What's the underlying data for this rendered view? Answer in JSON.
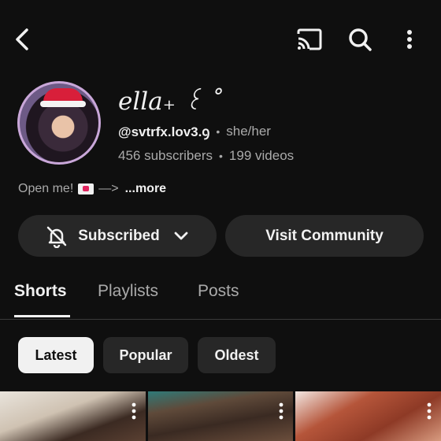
{
  "channel": {
    "name": "ella₊ ꒰ ˚",
    "handle": "@svtrfx.lov3.ꝯ",
    "pronouns": "she/her",
    "subscribers": "456 subscribers",
    "videos": "199 videos",
    "separator": "•",
    "description": "Open me!",
    "description_arrow": "—>",
    "more_label": "...more"
  },
  "buttons": {
    "subscribed_label": "Subscribed",
    "visit_community_label": "Visit Community"
  },
  "tabs": [
    {
      "label": "Shorts",
      "active": true
    },
    {
      "label": "Playlists",
      "active": false
    },
    {
      "label": "Posts",
      "active": false
    }
  ],
  "filters": [
    {
      "label": "Latest",
      "selected": true
    },
    {
      "label": "Popular",
      "selected": false
    },
    {
      "label": "Oldest",
      "selected": false
    }
  ],
  "icons": {
    "back": "back-arrow-icon",
    "cast": "cast-icon",
    "search": "search-icon",
    "more": "more-vertical-icon",
    "bell_off": "bell-off-icon",
    "chevron": "chevron-down-icon"
  },
  "colors": {
    "background": "#0f0f0f",
    "surface": "#272727",
    "text_primary": "#f1f1f1",
    "text_secondary": "#aaaaaa"
  }
}
